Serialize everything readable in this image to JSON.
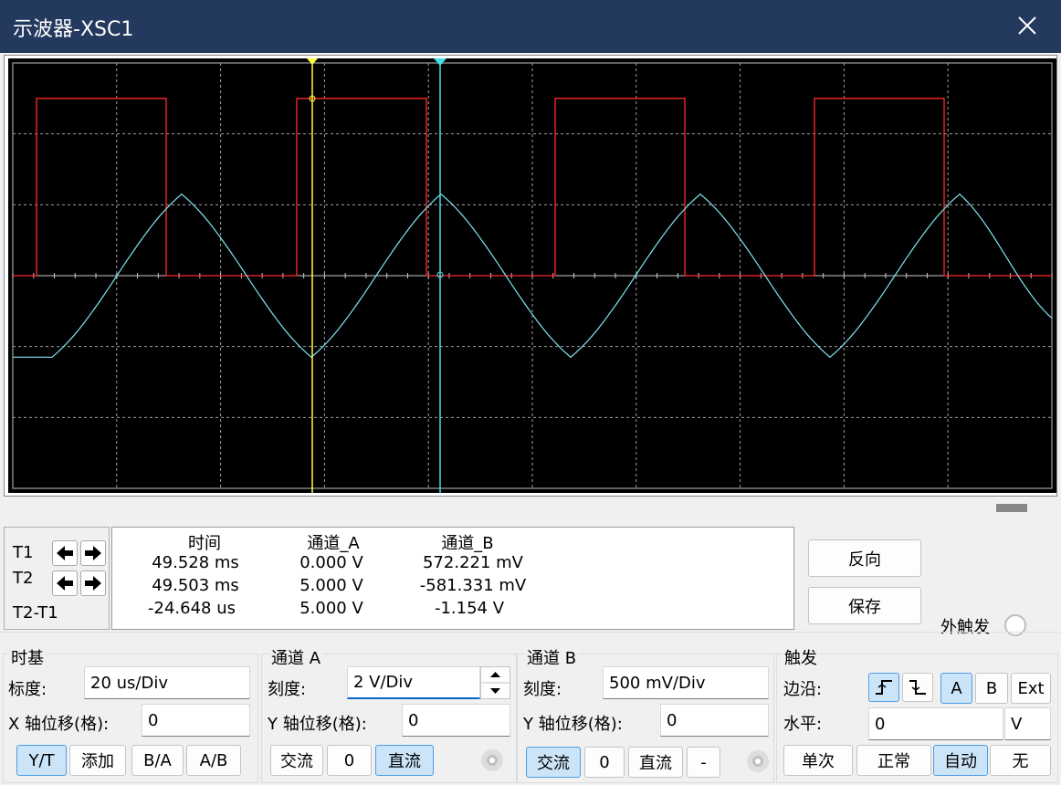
{
  "window": {
    "title": "示波器-XSC1"
  },
  "colors": {
    "trace_a": "#ff2a2a",
    "trace_b": "#7fe4f2",
    "cursor_t1": "#ffff40",
    "cursor_t2": "#40e0e8",
    "grid": "#a0a0a0",
    "screen_bg": "#000000"
  },
  "readout": {
    "headers": [
      "时间",
      "通道_A",
      "通道_B"
    ],
    "rows": [
      {
        "label": "T1",
        "time": "49.528 ms",
        "a": "0.000 V",
        "b": "572.221 mV"
      },
      {
        "label": "T2",
        "time": "49.503 ms",
        "a": "5.000 V",
        "b": "-581.331 mV"
      },
      {
        "label": "T2-T1",
        "time": "-24.648 us",
        "a": "5.000 V",
        "b": "-1.154 V"
      }
    ]
  },
  "buttons": {
    "reverse": "反向",
    "save": "保存",
    "ext_trigger": "外触发"
  },
  "timebase": {
    "title": "时基",
    "scale_label": "标度:",
    "scale_value": "20 us/Div",
    "xpos_label": "X 轴位移(格):",
    "xpos_value": "0",
    "modes": [
      "Y/T",
      "添加",
      "B/A",
      "A/B"
    ],
    "active_mode": "Y/T"
  },
  "channel_a": {
    "title": "通道 A",
    "scale_label": "刻度:",
    "scale_value": "2  V/Div",
    "ypos_label": "Y 轴位移(格):",
    "ypos_value": "0",
    "coupling": [
      "交流",
      "0",
      "直流"
    ],
    "active_coupling": "直流"
  },
  "channel_b": {
    "title": "通道 B",
    "scale_label": "刻度:",
    "scale_value": "500 mV/Div",
    "ypos_label": "Y 轴位移(格):",
    "ypos_value": "0",
    "coupling": [
      "交流",
      "0",
      "直流",
      "-"
    ],
    "active_coupling": "交流"
  },
  "trigger": {
    "title": "触发",
    "edge_label": "边沿:",
    "level_label": "水平:",
    "level_value": "0",
    "level_unit": "V",
    "sources": [
      "A",
      "B",
      "Ext"
    ],
    "active_source": "A",
    "modes": [
      "单次",
      "正常",
      "自动",
      "无"
    ],
    "active_mode": "自动"
  }
}
